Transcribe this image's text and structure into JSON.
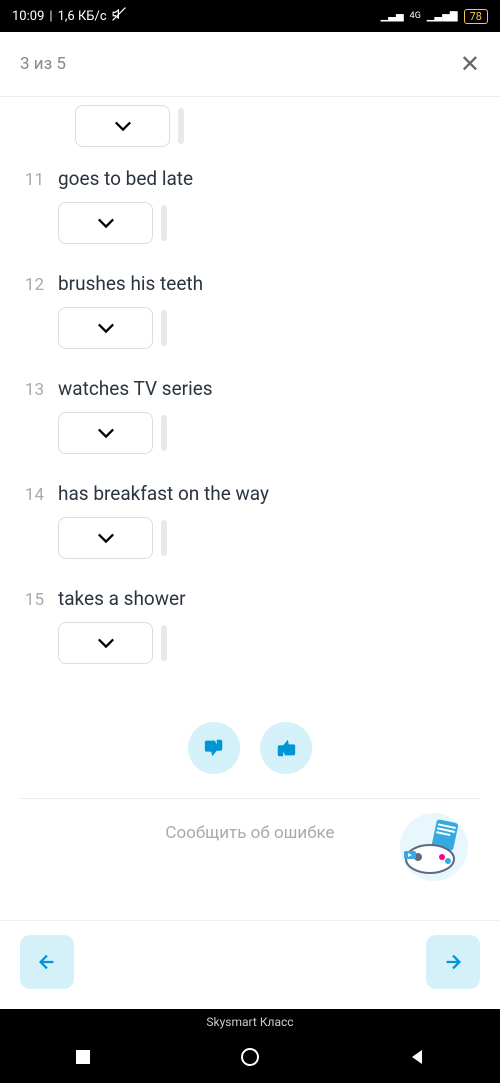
{
  "status": {
    "time": "10:09",
    "speed": "1,6 КБ/с",
    "network": "4G",
    "battery": "78"
  },
  "header": {
    "progress": "3 из 5"
  },
  "questions": [
    {
      "num": "11",
      "text": "goes to bed late"
    },
    {
      "num": "12",
      "text": "brushes his teeth"
    },
    {
      "num": "13",
      "text": "watches TV series"
    },
    {
      "num": "14",
      "text": "has breakfast on the way"
    },
    {
      "num": "15",
      "text": "takes a shower"
    }
  ],
  "report": {
    "label": "Сообщить об ошибке"
  },
  "app": {
    "name": "Skysmart Класс"
  }
}
